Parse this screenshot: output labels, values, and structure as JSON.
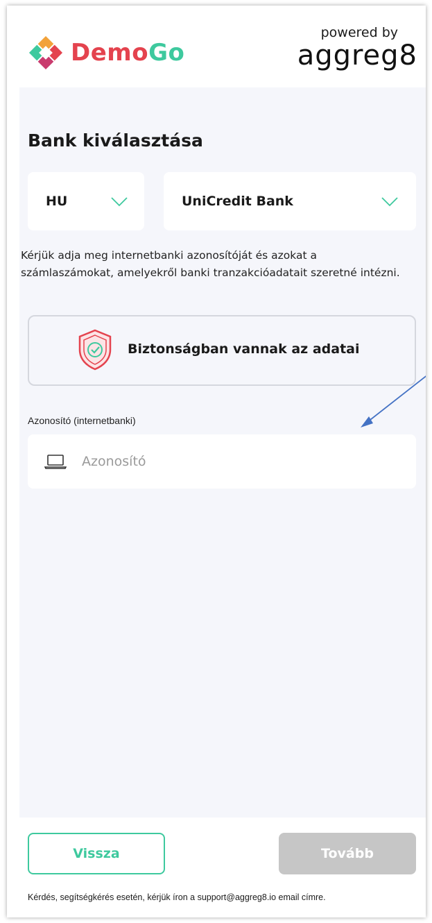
{
  "header": {
    "brand_demo": "Demo",
    "brand_go": "Go",
    "powered_by": "powered by",
    "powered_name": "aggreg8"
  },
  "page": {
    "title": "Bank kiválasztása"
  },
  "selects": {
    "country_value": "HU",
    "bank_value": "UniCredit Bank"
  },
  "intro_text": "Kérjük adja meg internetbanki azonosítóját és azokat a számlaszámokat, amelyekről banki tranzakcióadatait szeretné intézni.",
  "security": {
    "text": "Biztonságban vannak az adatai"
  },
  "login": {
    "label": "Azonosító (internetbanki)",
    "placeholder": "Azonosító",
    "value": ""
  },
  "buttons": {
    "back": "Vissza",
    "next": "Tovább"
  },
  "footer_text": "Kérdés, segítségkérés esetén, kérjük íron a support@aggreg8.io email címre.",
  "colors": {
    "brand_red": "#e4434e",
    "brand_green": "#3ec99e",
    "disabled_button": "#c6c6c6",
    "panel_background": "#f5f6fb",
    "arrow": "#4472c4"
  },
  "icons": {
    "logo": "demogo-diamond-logo",
    "chevron": "chevron-down-icon",
    "shield": "shield-check-icon",
    "laptop": "laptop-icon"
  }
}
